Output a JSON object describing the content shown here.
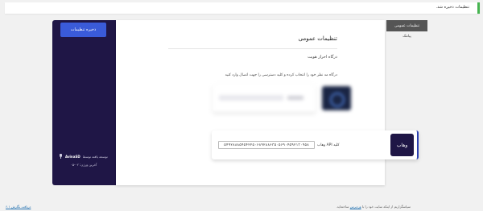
{
  "notice": {
    "text": "تنظیمات ذخیره شد."
  },
  "sidebar": {
    "save_label": "ذخیره تنظیمات",
    "powered_prefix": "توسعه یافته توسط",
    "powered_brand": "AvinaSD",
    "version": "آخرین ورژن: ۰۲-۰۵"
  },
  "panel": {
    "title": "تنظیمات عمومی",
    "section_title": "درگاه احراز هویت",
    "description": "درگاه مد نظر خود را انتخاب کرده و کلید دسترسی را جهت اتصال وارد کنید"
  },
  "gateway_active": {
    "brand": "وهاب",
    "api_label": "کلید API وهاب",
    "api_value": "۵۴۹۲۸۸۸۵۴۵۴۲۲۵۰۶۸۹۲۸۸۶۳۵۰۵۶۹۰۴۵۹۲۱۳۰۹۵۸"
  },
  "tabs": {
    "active": "تنظیمات عمومی",
    "second": "پیامک"
  },
  "footer": {
    "thanks_prefix": "سپاسگزاریم از اینکه سایت خود را با",
    "wp_link": "وردپرس",
    "thanks_suffix": "ساخته‌اید.",
    "version_link": "دریافت نگارش ۶.۱"
  },
  "colors": {
    "sidebar_bg": "#1f1646",
    "accent": "#3a5bd9",
    "notice_border": "#46b450"
  }
}
